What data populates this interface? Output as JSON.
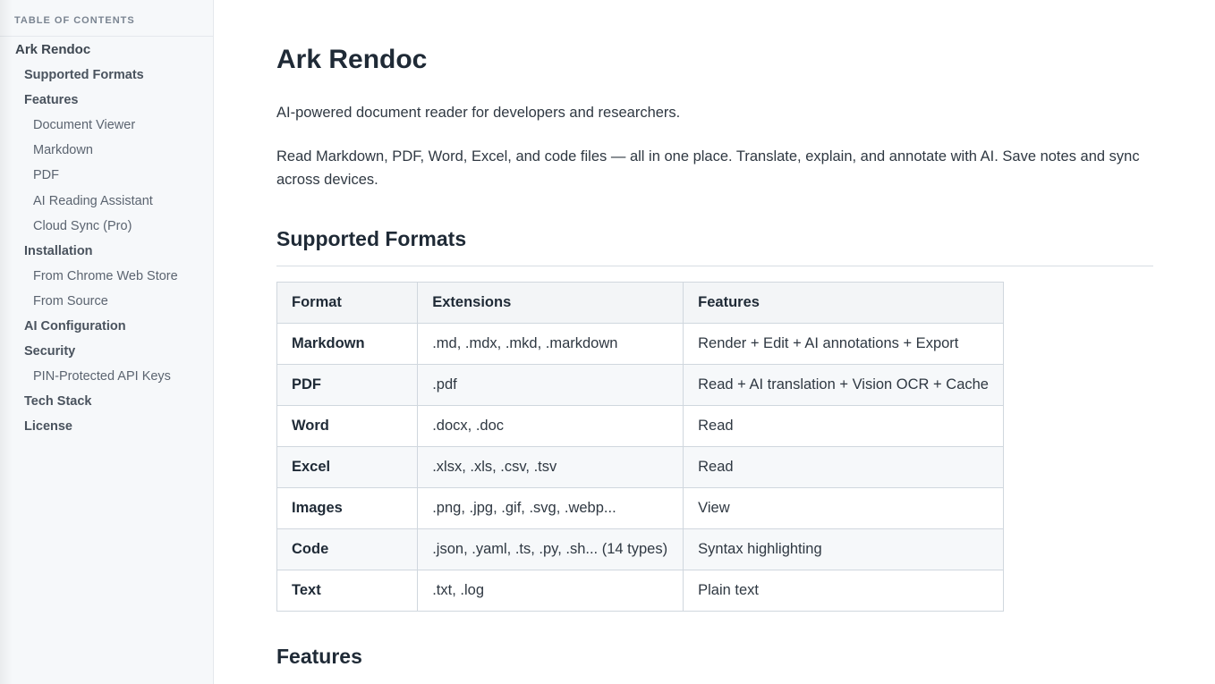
{
  "sidebar": {
    "header": "TABLE OF CONTENTS",
    "items": [
      {
        "label": "Ark Rendoc",
        "level": 1
      },
      {
        "label": "Supported Formats",
        "level": 2
      },
      {
        "label": "Features",
        "level": 2
      },
      {
        "label": "Document Viewer",
        "level": 3
      },
      {
        "label": "Markdown",
        "level": 3
      },
      {
        "label": "PDF",
        "level": 3
      },
      {
        "label": "AI Reading Assistant",
        "level": 3
      },
      {
        "label": "Cloud Sync (Pro)",
        "level": 3
      },
      {
        "label": "Installation",
        "level": 2
      },
      {
        "label": "From Chrome Web Store",
        "level": 3
      },
      {
        "label": "From Source",
        "level": 3
      },
      {
        "label": "AI Configuration",
        "level": 2
      },
      {
        "label": "Security",
        "level": 2
      },
      {
        "label": "PIN-Protected API Keys",
        "level": 3
      },
      {
        "label": "Tech Stack",
        "level": 2
      },
      {
        "label": "License",
        "level": 2
      }
    ]
  },
  "main": {
    "title": "Ark Rendoc",
    "lead": "AI-powered document reader for developers and researchers.",
    "description": "Read Markdown, PDF, Word, Excel, and code files — all in one place. Translate, explain, and annotate with AI. Save notes and sync across devices.",
    "section_formats": "Supported Formats",
    "table": {
      "headers": [
        "Format",
        "Extensions",
        "Features"
      ],
      "rows": [
        [
          "Markdown",
          ".md, .mdx, .mkd, .markdown",
          "Render + Edit + AI annotations + Export"
        ],
        [
          "PDF",
          ".pdf",
          "Read + AI translation + Vision OCR + Cache"
        ],
        [
          "Word",
          ".docx, .doc",
          "Read"
        ],
        [
          "Excel",
          ".xlsx, .xls, .csv, .tsv",
          "Read"
        ],
        [
          "Images",
          ".png, .jpg, .gif, .svg, .webp...",
          "View"
        ],
        [
          "Code",
          ".json, .yaml, .ts, .py, .sh... (14 types)",
          "Syntax highlighting"
        ],
        [
          "Text",
          ".txt, .log",
          "Plain text"
        ]
      ]
    },
    "section_features": "Features"
  }
}
